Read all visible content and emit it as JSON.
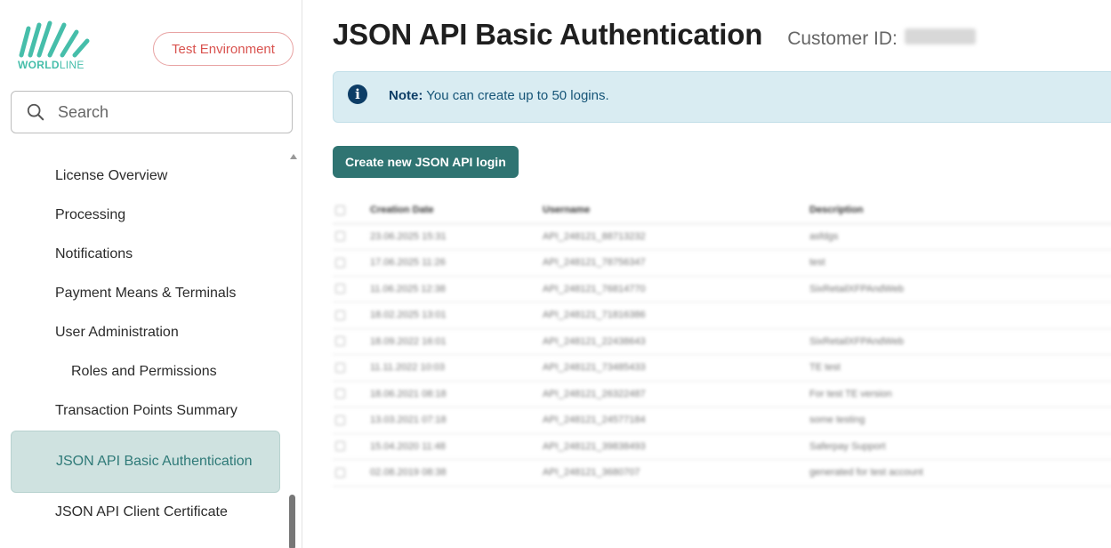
{
  "brand": {
    "logo_text_bold": "WORLD",
    "logo_text_light": "LINE",
    "accent": "#46beaa"
  },
  "sidebar": {
    "environment_badge": "Test Environment",
    "search_placeholder": "Search",
    "items": [
      {
        "label": "License Overview"
      },
      {
        "label": "Processing"
      },
      {
        "label": "Notifications"
      },
      {
        "label": "Payment Means & Terminals"
      },
      {
        "label": "User Administration"
      },
      {
        "label": "Roles and Permissions"
      },
      {
        "label": "Transaction Points Summary"
      },
      {
        "label": "JSON API Basic Authentication"
      },
      {
        "label": "JSON API Client Certificate"
      }
    ],
    "active_color": "#cfe2e0"
  },
  "main": {
    "title": "JSON API Basic Authentication",
    "customer_id_label": "Customer ID:",
    "note_label": "Note:",
    "note_text": " You can create up to 50 logins.",
    "create_button": "Create new JSON API login",
    "button_color": "#2f7472"
  },
  "table": {
    "headers": [
      "Creation Date",
      "Username",
      "Description"
    ],
    "rows": [
      [
        "23.06.2025 15:31",
        "API_248121_88713232",
        "asfdgs"
      ],
      [
        "17.06.2025 11:26",
        "API_248121_78756347",
        "test"
      ],
      [
        "11.06.2025 12:38",
        "API_248121_76814770",
        "SixRetailXFPAndWeb"
      ],
      [
        "18.02.2025 13:01",
        "API_248121_71816386",
        ""
      ],
      [
        "18.09.2022 16:01",
        "API_248121_22438643",
        "SixRetailXFPAndWeb"
      ],
      [
        "11.11.2022 10:03",
        "API_248121_73485433",
        "TE test"
      ],
      [
        "18.06.2021 08:18",
        "API_248121_26322487",
        "For test TE version"
      ],
      [
        "13.03.2021 07:18",
        "API_248121_24577184",
        "some testing"
      ],
      [
        "15.04.2020 11:48",
        "API_248121_39838493",
        "Saferpay Support"
      ],
      [
        "02.08.2019 08:38",
        "API_248121_3680707",
        "generated for test account"
      ]
    ]
  }
}
